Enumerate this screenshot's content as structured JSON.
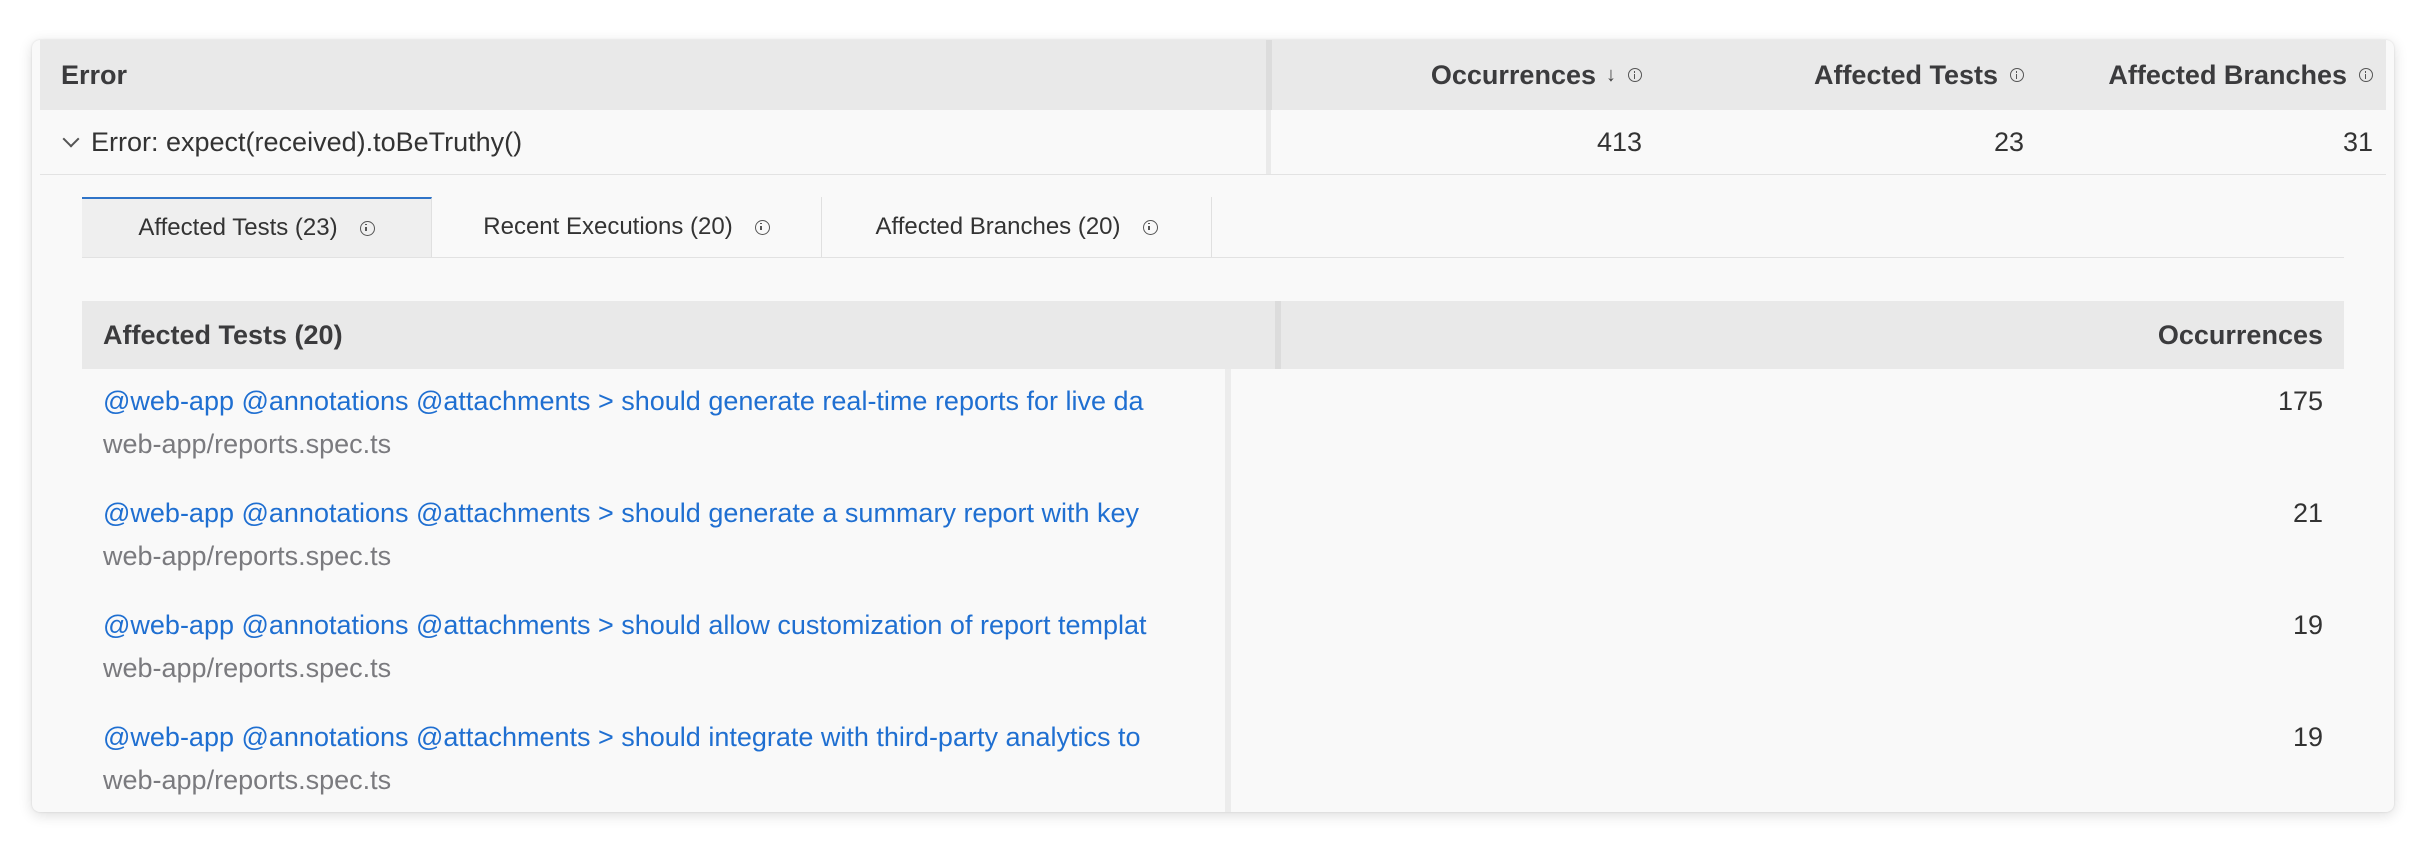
{
  "error_table": {
    "headers": {
      "error": "Error",
      "occurrences": "Occurrences",
      "affected_tests": "Affected Tests",
      "affected_branches": "Affected Branches"
    },
    "sort_icon": "↓",
    "row": {
      "message": "Error: expect(received).toBeTruthy()",
      "occurrences": "413",
      "affected_tests": "23",
      "affected_branches": "31"
    }
  },
  "tabs": [
    {
      "label": "Affected Tests (23)",
      "active": true
    },
    {
      "label": "Recent Executions (20)",
      "active": false
    },
    {
      "label": "Affected Branches (20)",
      "active": false
    }
  ],
  "affected_tests_table": {
    "headers": {
      "name": "Affected Tests (20)",
      "occurrences": "Occurrences"
    },
    "rows": [
      {
        "name": "@web-app @annotations @attachments > should generate real-time reports for live da",
        "file": "web-app/reports.spec.ts",
        "occurrences": "175"
      },
      {
        "name": "@web-app @annotations @attachments > should generate a summary report with key",
        "file": "web-app/reports.spec.ts",
        "occurrences": "21"
      },
      {
        "name": "@web-app @annotations @attachments > should allow customization of report templat",
        "file": "web-app/reports.spec.ts",
        "occurrences": "19"
      },
      {
        "name": "@web-app @annotations @attachments > should integrate with third-party analytics to",
        "file": "web-app/reports.spec.ts",
        "occurrences": "19"
      }
    ]
  },
  "colors": {
    "link": "#1f6fd1",
    "active_tab_border": "#2f74c8",
    "header_bg": "#e9e9e9"
  }
}
